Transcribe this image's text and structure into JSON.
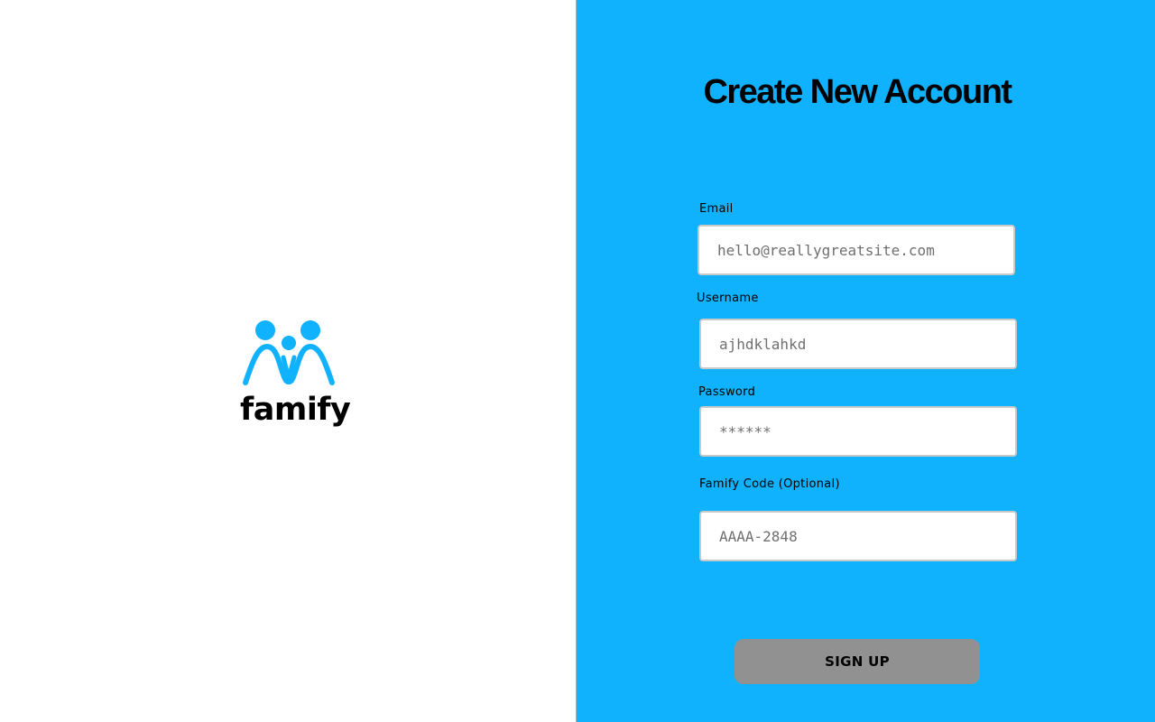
{
  "brand": {
    "name": "famify",
    "logo_icon": "family-icon",
    "primary_color": "#10b2fe"
  },
  "form": {
    "title": "Create New Account",
    "fields": {
      "email": {
        "label": "Email",
        "placeholder": "hello@reallygreatsite.com"
      },
      "username": {
        "label": "Username",
        "placeholder": "ajhdklahkd"
      },
      "password": {
        "label": "Password",
        "placeholder": "******"
      },
      "famify_code": {
        "label": "Famify Code (Optional)",
        "placeholder": "AAAA-2848"
      }
    },
    "submit_label": "SIGN UP",
    "submit_color": "#919191"
  }
}
